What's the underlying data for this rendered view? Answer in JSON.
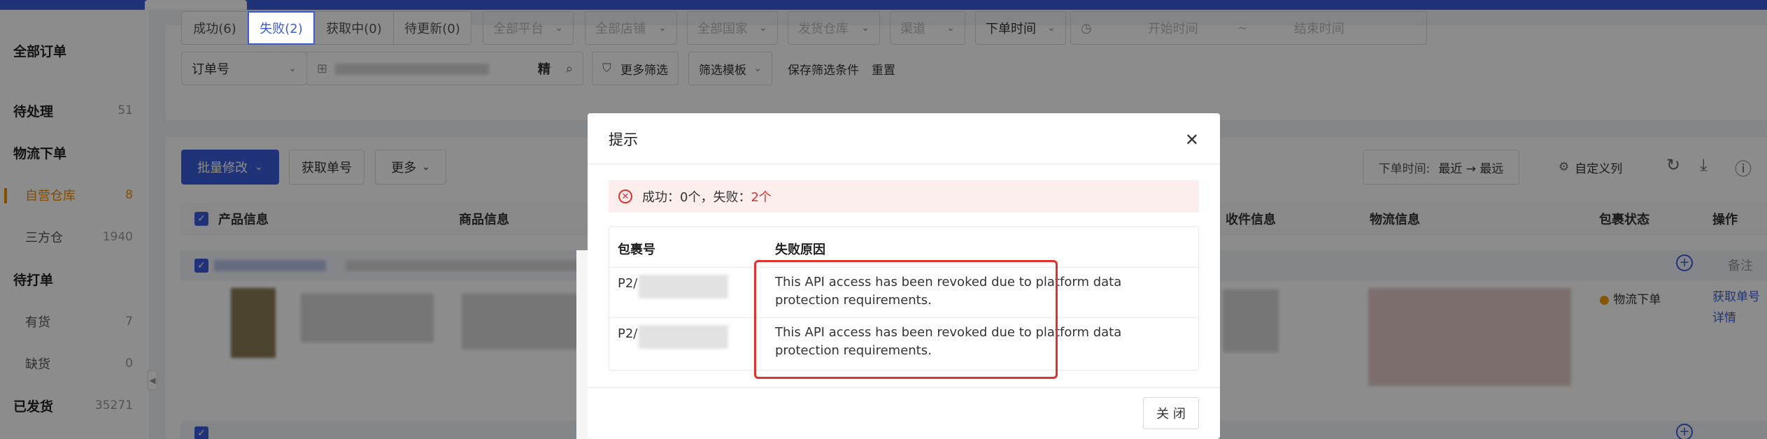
{
  "sidebar": {
    "items": [
      {
        "label": "全部订单",
        "count": ""
      },
      {
        "label": "待处理",
        "count": "51"
      },
      {
        "label": "物流下单",
        "count": ""
      },
      {
        "label": "自营仓库",
        "count": "8"
      },
      {
        "label": "三方仓",
        "count": "1940"
      },
      {
        "label": "待打单",
        "count": ""
      },
      {
        "label": "有货",
        "count": "7"
      },
      {
        "label": "缺货",
        "count": "0"
      },
      {
        "label": "已发货",
        "count": "35271"
      }
    ]
  },
  "filters": {
    "status_tabs": [
      "成功(6)",
      "失败(2)",
      "获取中(0)",
      "待更新(0)"
    ],
    "selects": [
      "全部平台",
      "全部店铺",
      "全部国家",
      "发货仓库",
      "渠道",
      "下单时间"
    ],
    "date_start": "开始时间",
    "date_sep": "~",
    "date_end": "结束时间",
    "order_no": "订单号",
    "exact_label": "精",
    "more_filter": "更多筛选",
    "filter_template": "筛选模板",
    "save_filter": "保存筛选条件",
    "reset": "重置"
  },
  "toolbar": {
    "batch_edit": "批量修改",
    "get_tracking": "获取单号",
    "more": "更多",
    "sort_label": "下单时间:",
    "sort_value": "最近 → 最远",
    "custom_columns": "自定义列"
  },
  "table": {
    "headers": [
      "产品信息",
      "商品信息",
      "收件信息",
      "物流信息",
      "包裹状态",
      "操作"
    ],
    "row": {
      "remark": "备注",
      "status": "物流下单",
      "action_get": "获取单号",
      "action_detail": "详情"
    }
  },
  "modal": {
    "title": "提示",
    "alert_prefix": "成功：0个，失败：",
    "alert_fail": "2个",
    "col_package": "包裹号",
    "col_reason": "失败原因",
    "rows": [
      {
        "package": "P2/",
        "reason": "This API access has been revoked due to platform data protection requirements."
      },
      {
        "package": "P2/",
        "reason": "This API access has been revoked due to platform data protection requirements."
      }
    ],
    "close_label": "关 闭"
  },
  "colors": {
    "accent": "#3b5bdb",
    "active_sidebar": "#f08c00",
    "error": "#e03131"
  }
}
